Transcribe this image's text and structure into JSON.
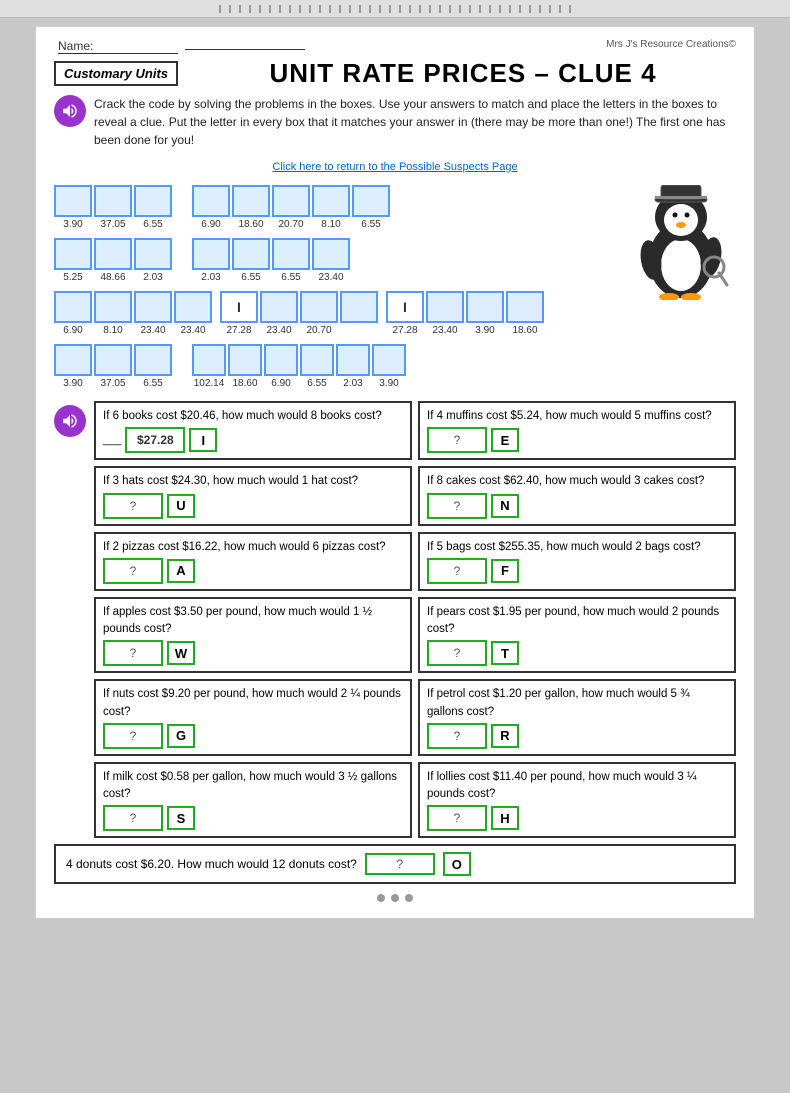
{
  "topbar": {
    "label": "ruler ticks"
  },
  "header": {
    "name_label": "Name:",
    "copyright": "Mrs J's Resource Creations©",
    "badge": "Customary Units",
    "title": "UNIT RATE PRICES – CLUE 4"
  },
  "instructions": {
    "text": "Crack the code by solving the problems in the boxes. Use your answers to match and place the letters  in the boxes to reveal a clue.  Put the letter in every box that it matches  your answer in (there may be more than one!) The first one has been done for you!",
    "link": "Click here to return to the Possible Suspects Page"
  },
  "puzzle": {
    "row1_left": {
      "values": [
        "3.90",
        "37.05",
        "6.55"
      ]
    },
    "row1_right": {
      "values": [
        "6.90",
        "18.60",
        "20.70",
        "8.10",
        "6.55"
      ]
    },
    "row2_left": {
      "values": [
        "5.25",
        "48.66",
        "2.03"
      ]
    },
    "row2_right": {
      "values": [
        "2.03",
        "6.55",
        "6.55",
        "23.40"
      ]
    },
    "row3_left": {
      "values": [
        "6.90",
        "8.10",
        "23.40",
        "23.40"
      ],
      "i_pos": null,
      "middle_values": [
        "27.28",
        "23.40",
        "20.70"
      ],
      "i_at": 0
    },
    "row3_right": {
      "i_at": 0,
      "values": [
        "27.28",
        "23.40",
        "3.90",
        "18.60"
      ]
    },
    "row4_left": {
      "values": [
        "3.90",
        "37.05",
        "6.55"
      ]
    },
    "row4_right": {
      "values": [
        "102.14",
        "18.60",
        "6.90",
        "6.55",
        "2.03",
        "3.90"
      ]
    }
  },
  "problems": [
    {
      "id": "p1",
      "text": "If 6 books cost $20.46, how much would 8 books cost?",
      "answer": "$27.28",
      "letter": "I",
      "answer_filled": true,
      "letter_filled": true
    },
    {
      "id": "p2",
      "text": "If 4 muffins cost $5.24, how much would 5 muffins cost?",
      "answer": "?",
      "letter": "E",
      "answer_filled": false,
      "letter_filled": true
    },
    {
      "id": "p3",
      "text": "If 3 hats cost $24.30, how much would 1 hat cost?",
      "answer": "?",
      "letter": "U",
      "answer_filled": false,
      "letter_filled": true
    },
    {
      "id": "p4",
      "text": "If 8 cakes cost $62.40, how much would 3 cakes cost?",
      "answer": "?",
      "letter": "N",
      "answer_filled": false,
      "letter_filled": true
    },
    {
      "id": "p5",
      "text": "If 2 pizzas cost $16.22, how much would 6 pizzas cost?",
      "answer": "?",
      "letter": "A",
      "answer_filled": false,
      "letter_filled": true
    },
    {
      "id": "p6",
      "text": "If 5 bags cost $255.35, how much would 2 bags cost?",
      "answer": "?",
      "letter": "F",
      "answer_filled": false,
      "letter_filled": true
    },
    {
      "id": "p7",
      "text": "If apples cost $3.50 per pound, how much would 1 ½ pounds cost?",
      "answer": "?",
      "letter": "W",
      "answer_filled": false,
      "letter_filled": true
    },
    {
      "id": "p8",
      "text": "If pears cost $1.95 per pound, how much would 2 pounds cost?",
      "answer": "?",
      "letter": "T",
      "answer_filled": false,
      "letter_filled": true
    },
    {
      "id": "p9",
      "text": "If nuts cost $9.20 per pound, how much would 2 ¼ pounds cost?",
      "answer": "?",
      "letter": "G",
      "answer_filled": false,
      "letter_filled": true
    },
    {
      "id": "p10",
      "text": "If petrol cost $1.20 per gallon, how much would 5 ¾ gallons cost?",
      "answer": "?",
      "letter": "R",
      "answer_filled": false,
      "letter_filled": true
    },
    {
      "id": "p11",
      "text": "If milk cost $0.58 per gallon, how much would 3 ½ gallons cost?",
      "answer": "?",
      "letter": "S",
      "answer_filled": false,
      "letter_filled": true
    },
    {
      "id": "p12",
      "text": "If lollies cost $11.40 per pound, how much would 3 ¼ pounds cost?",
      "answer": "?",
      "letter": "H",
      "answer_filled": false,
      "letter_filled": true
    }
  ],
  "bottom_problem": {
    "text": "4 donuts cost $6.20. How much would 12 donuts cost?",
    "answer": "?",
    "letter": "O"
  }
}
